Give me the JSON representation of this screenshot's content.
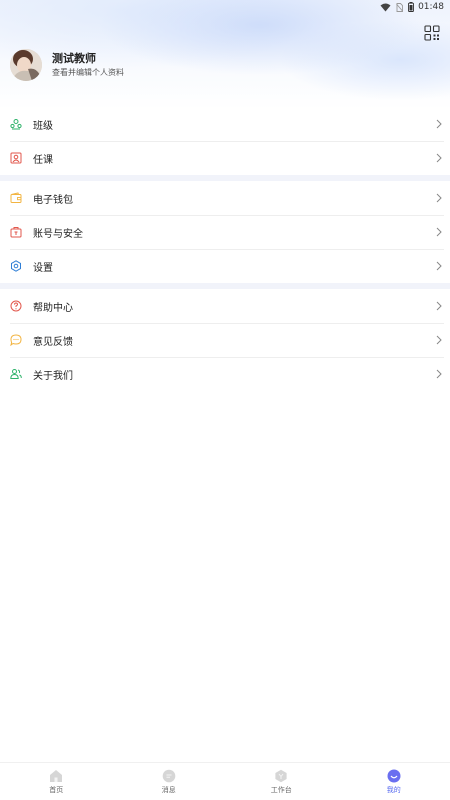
{
  "status_bar": {
    "time": "01:48"
  },
  "profile": {
    "name": "测试教师",
    "subtitle": "查看并编辑个人资料"
  },
  "menu": {
    "group1": [
      {
        "label": "班级",
        "icon": "class-icon",
        "color": "#2fb36b"
      },
      {
        "label": "任课",
        "icon": "teacher-icon",
        "color": "#e2574c"
      }
    ],
    "group2": [
      {
        "label": "电子钱包",
        "icon": "wallet-icon",
        "color": "#f2b441"
      },
      {
        "label": "账号与安全",
        "icon": "security-icon",
        "color": "#e2574c"
      },
      {
        "label": "设置",
        "icon": "gear-icon",
        "color": "#2f7fd6"
      }
    ],
    "group3": [
      {
        "label": "帮助中心",
        "icon": "help-icon",
        "color": "#e2574c"
      },
      {
        "label": "意见反馈",
        "icon": "feedback-icon",
        "color": "#f2b441"
      },
      {
        "label": "关于我们",
        "icon": "about-icon",
        "color": "#2fb36b"
      }
    ]
  },
  "tabbar": {
    "items": [
      {
        "label": "首页",
        "icon": "home-icon",
        "active": false
      },
      {
        "label": "消息",
        "icon": "message-icon",
        "active": false
      },
      {
        "label": "工作台",
        "icon": "workbench-icon",
        "active": false
      },
      {
        "label": "我的",
        "icon": "profile-icon",
        "active": true
      }
    ],
    "active_color": "#5a6cf0"
  }
}
